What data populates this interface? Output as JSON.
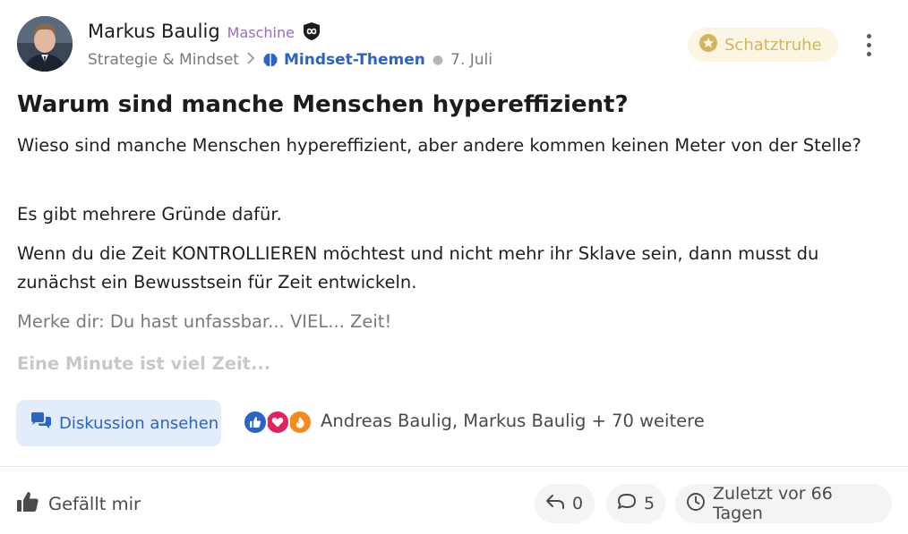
{
  "author": {
    "name": "Markus Baulig",
    "role": "Maschine",
    "role_badge_icon": "infinity-shield-icon"
  },
  "meta": {
    "category": "Strategie & Mindset",
    "subcategory": "Mindset-Themen",
    "subcategory_icon": "brain-icon",
    "date": "7. Juli"
  },
  "treasure": {
    "label": "Schatztruhe",
    "icon": "star-coin-icon"
  },
  "post": {
    "title": "Warum sind manche Menschen hypereffizient?",
    "paragraphs": [
      "Wieso sind manche Menschen hypereffizient, aber andere kommen keinen Meter von der Stelle?",
      "Es gibt mehrere Gründe dafür.",
      "Wenn du die Zeit KONTROLLIEREN möchtest und nicht mehr ihr Sklave sein, dann musst du zunächst ein Bewusstsein für Zeit entwickeln.",
      "Merke dir: Du hast unfassbar... VIEL... Zeit!",
      "Eine Minute ist viel Zeit..."
    ]
  },
  "actions": {
    "discussion_label": "Diskussion ansehen",
    "reactions": [
      "like",
      "love",
      "fire"
    ],
    "reacted_by": "Andreas Baulig, Markus Baulig + 70 weitere"
  },
  "footer": {
    "like_label": "Gefällt mir",
    "shares": "0",
    "comments": "5",
    "last_activity": "Zuletzt vor 66 Tagen"
  },
  "colors": {
    "accent_blue": "#2a64c4",
    "role_purple": "#9a6ac8",
    "treasure_gold": "#d4b45c"
  }
}
